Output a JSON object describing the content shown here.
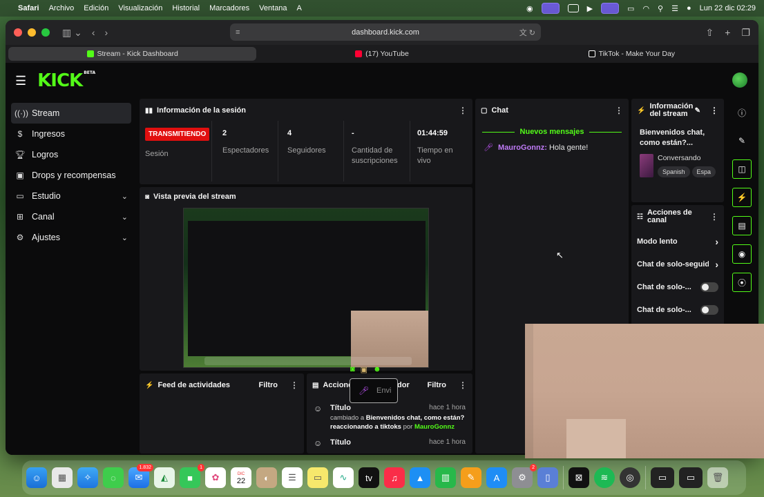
{
  "menubar": {
    "items": [
      "Safari",
      "Archivo",
      "Edición",
      "Visualización",
      "Historial",
      "Marcadores",
      "Ventana",
      "A"
    ],
    "clock": "Lun 22 dic  02:29"
  },
  "browser": {
    "url": "dashboard.kick.com",
    "tabs": [
      {
        "label": "Stream - Kick Dashboard",
        "color": "#53fc18"
      },
      {
        "label": "(17) YouTube",
        "color": "#ff0033"
      },
      {
        "label": "TikTok - Make Your Day",
        "color": "#ffffff"
      }
    ]
  },
  "kick": {
    "logo": "KICK",
    "logo_sup": "BETA",
    "sidebar": [
      {
        "label": "Stream",
        "icon": "radio-icon"
      },
      {
        "label": "Ingresos",
        "icon": "dollar-icon"
      },
      {
        "label": "Logros",
        "icon": "trophy-icon"
      },
      {
        "label": "Drops y recompensas",
        "icon": "gift-icon"
      },
      {
        "label": "Estudio",
        "icon": "studio-icon"
      },
      {
        "label": "Canal",
        "icon": "channel-icon"
      },
      {
        "label": "Ajustes",
        "icon": "gear-icon"
      }
    ],
    "session": {
      "title": "Información de la sesión",
      "live": "TRANSMITIENDO",
      "session_label": "Sesión",
      "stats": [
        {
          "value": "2",
          "label": "Espectadores"
        },
        {
          "value": "4",
          "label": "Seguidores"
        },
        {
          "value": "-",
          "label": "Cantidad de suscripciones"
        },
        {
          "value": "01:44:59",
          "label": "Tiempo en vivo"
        }
      ]
    },
    "preview_title": "Vista previa del stream",
    "chat": {
      "title": "Chat",
      "new_messages": "Nuevos mensajes",
      "messages": [
        {
          "user": "MauroGonnz:",
          "text": " Hola gente!"
        }
      ],
      "input_placeholder": "Envi"
    },
    "stream_info": {
      "title": "Información del stream",
      "stream_title": "Bienvenidos chat, como están?...",
      "category": "Conversando",
      "tags": [
        "Spanish",
        "Espa"
      ]
    },
    "channel_actions": {
      "title": "Acciones de canal",
      "items": [
        {
          "label": "Modo lento",
          "type": "arrow"
        },
        {
          "label": "Chat de solo-seguid",
          "type": "arrow"
        },
        {
          "label": "Chat de solo-...",
          "type": "toggle"
        },
        {
          "label": "Chat de solo-...",
          "type": "toggle"
        }
      ]
    },
    "activity_feed": {
      "title": "Feed de actividades",
      "filter": "Filtro"
    },
    "mod_actions": {
      "title": "Acciones de moderador",
      "filter": "Filtro",
      "items": [
        {
          "title": "Título",
          "time": "hace 1 hora",
          "pre": "cambiado a ",
          "bold": "Bienvenidos chat, como están? reaccionando a tiktoks",
          "by": " por ",
          "user": "MauroGonnz"
        },
        {
          "title": "Título",
          "time": "hace 1 hora"
        }
      ]
    }
  },
  "dock": {
    "mail_badge": "1.832",
    "facetime_badge": "1",
    "calendar_month": "DIC",
    "calendar_day": "22",
    "settings_badge": "2"
  }
}
